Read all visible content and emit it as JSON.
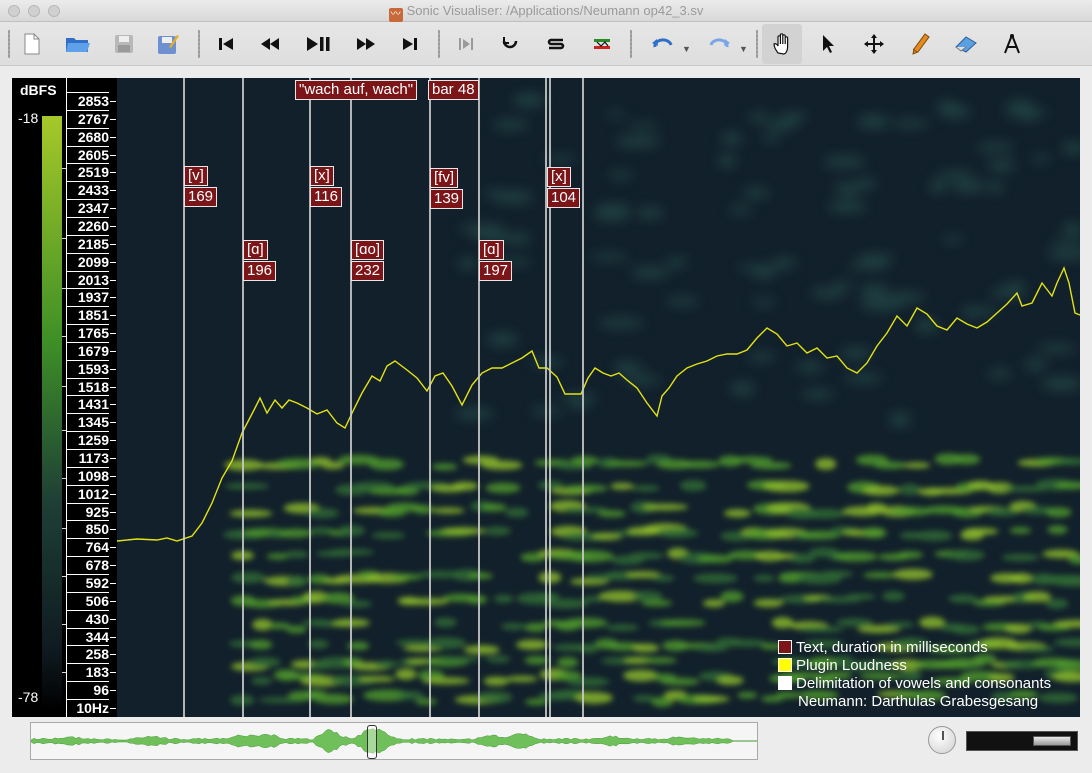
{
  "window": {
    "title": "Sonic Visualiser: /Applications/Neumann op42_3.sv"
  },
  "toolbar": {
    "tools": [
      {
        "id": "new",
        "name": "new-file-icon"
      },
      {
        "id": "open",
        "name": "open-folder-icon"
      },
      {
        "id": "save",
        "name": "save-icon"
      },
      {
        "id": "save-session",
        "name": "save-session-icon"
      },
      {
        "id": "rewind-start",
        "name": "rewind-start-icon"
      },
      {
        "id": "rewind",
        "name": "rewind-icon"
      },
      {
        "id": "play-pause",
        "name": "play-pause-icon"
      },
      {
        "id": "fast-forward",
        "name": "fast-forward-icon"
      },
      {
        "id": "fast-forward-end",
        "name": "fast-forward-end-icon"
      },
      {
        "id": "play-selection",
        "name": "play-selection-icon"
      },
      {
        "id": "loop",
        "name": "loop-icon"
      },
      {
        "id": "solo",
        "name": "solo-icon"
      },
      {
        "id": "speed",
        "name": "speed-icon"
      },
      {
        "id": "undo",
        "name": "undo-icon"
      },
      {
        "id": "redo",
        "name": "redo-icon"
      },
      {
        "id": "navigate",
        "name": "hand-navigate-icon",
        "selected": true
      },
      {
        "id": "select",
        "name": "select-arrow-icon"
      },
      {
        "id": "move",
        "name": "move-cross-icon"
      },
      {
        "id": "draw",
        "name": "pencil-draw-icon"
      },
      {
        "id": "erase",
        "name": "eraser-icon"
      },
      {
        "id": "measure",
        "name": "measure-compass-icon"
      }
    ]
  },
  "scale": {
    "unit": "dBFS",
    "top": "-18",
    "bottom": "-78"
  },
  "frequency_labels": [
    "2853",
    "2767",
    "2680",
    "2605",
    "2519",
    "2433",
    "2347",
    "2260",
    "2185",
    "2099",
    "2013",
    "1937",
    "1851",
    "1765",
    "1679",
    "1593",
    "1518",
    "1431",
    "1345",
    "1259",
    "1173",
    "1098",
    "1012",
    "925",
    "850",
    "764",
    "678",
    "592",
    "506",
    "430",
    "344",
    "258",
    "183",
    "96",
    "10Hz"
  ],
  "annotations": {
    "title_box": "\"wach auf, wach\"",
    "bar_box": "bar 48",
    "phonemes": [
      {
        "symbol": "[v]",
        "duration": "169"
      },
      {
        "symbol": "[ɑ]",
        "duration": "196"
      },
      {
        "symbol": "[x]",
        "duration": "116"
      },
      {
        "symbol": "[ɑo]",
        "duration": "232"
      },
      {
        "symbol": "[fv]",
        "duration": "139"
      },
      {
        "symbol": "[ɑ]",
        "duration": "197"
      },
      {
        "symbol": "[x]",
        "duration": "104"
      }
    ]
  },
  "legend": {
    "items": [
      {
        "label": "Text, duration in milliseconds",
        "color": "#7c1518"
      },
      {
        "label": "Plugin Loudness",
        "color": "#ffff00"
      },
      {
        "label": "Delimitation of vowels and consonants",
        "color": "#ffffff"
      }
    ],
    "caption": "Neumann: Darthulas Grabesgesang"
  },
  "colors": {
    "spectrogram_bg": "#12202b",
    "loudness_curve": "#e3e313",
    "annotation_box": "#7c1518"
  }
}
